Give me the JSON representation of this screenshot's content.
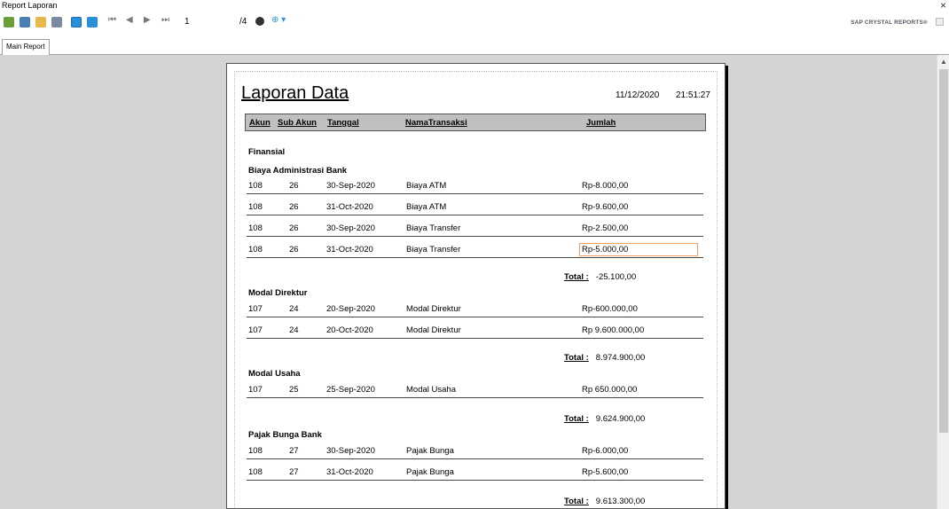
{
  "window": {
    "title": "Report Laporan",
    "close": "×"
  },
  "toolbar": {
    "page_current": "1",
    "page_total": "/4",
    "nav": [
      "⏮",
      "◀",
      "▶",
      "⏭"
    ],
    "zoom_glyph": "⊕ ▾",
    "brand": "SAP CRYSTAL REPORTS®"
  },
  "tabs": [
    {
      "label": "Main Report"
    }
  ],
  "report": {
    "title": "Laporan Data",
    "date": "11/12/2020",
    "time": "21:51:27",
    "columns": [
      "Akun",
      "Sub Akun",
      "Tanggal",
      "NamaTransaksi",
      "Jumlah"
    ],
    "section": "Finansial",
    "total_label": "Total :",
    "groups": [
      {
        "name": "Biaya Administrasi Bank",
        "rows": [
          [
            "108",
            "26",
            "30-Sep-2020",
            "Biaya ATM",
            "Rp-8.000,00"
          ],
          [
            "108",
            "26",
            "31-Oct-2020",
            "Biaya ATM",
            "Rp-9.600,00"
          ],
          [
            "108",
            "26",
            "30-Sep-2020",
            "Biaya Transfer",
            "Rp-2.500,00"
          ],
          [
            "108",
            "26",
            "31-Oct-2020",
            "Biaya Transfer",
            "Rp-5.000,00"
          ]
        ],
        "total": "-25.100,00"
      },
      {
        "name": "Modal Direktur",
        "rows": [
          [
            "107",
            "24",
            "20-Sep-2020",
            "Modal Direktur",
            "Rp-600.000,00"
          ],
          [
            "107",
            "24",
            "20-Oct-2020",
            "Modal Direktur",
            "Rp 9.600.000,00"
          ]
        ],
        "total": "8.974.900,00"
      },
      {
        "name": "Modal Usaha",
        "rows": [
          [
            "107",
            "25",
            "25-Sep-2020",
            "Modal Usaha",
            "Rp 650.000,00"
          ]
        ],
        "total": "9.624.900,00"
      },
      {
        "name": "Pajak Bunga Bank",
        "rows": [
          [
            "108",
            "27",
            "30-Sep-2020",
            "Pajak Bunga",
            "Rp-6.000,00"
          ],
          [
            "108",
            "27",
            "31-Oct-2020",
            "Pajak Bunga",
            "Rp-5.600,00"
          ]
        ],
        "total": "9.613.300,00"
      }
    ]
  },
  "colors": {
    "viewer_bg": "#d4d4d4",
    "header_bg": "#c0c0c0",
    "toolbar_accent": "#2a8fd6"
  }
}
